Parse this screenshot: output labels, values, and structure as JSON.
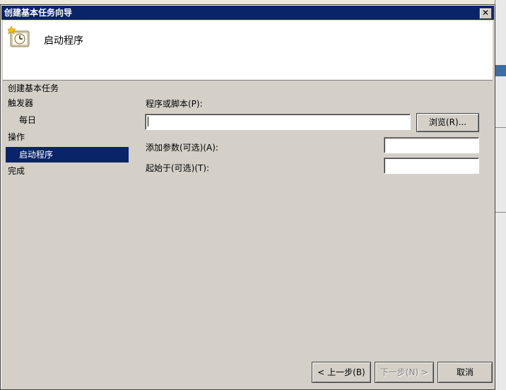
{
  "window": {
    "title": "创建基本任务向导",
    "close_symbol": "✕"
  },
  "header": {
    "title": "启动程序",
    "icon": "clock-icon"
  },
  "sidebar": {
    "heading": "创建基本任务",
    "items": [
      {
        "label": "触发器"
      },
      {
        "label": "每日"
      },
      {
        "label": "操作"
      },
      {
        "label": "启动程序"
      },
      {
        "label": "完成"
      }
    ]
  },
  "form": {
    "program_label": "程序或脚本(P):",
    "program_value": "",
    "browse_label": "浏览(R)...",
    "args_label": "添加参数(可选)(A):",
    "args_value": "",
    "startin_label": "起始于(可选)(T):",
    "startin_value": ""
  },
  "footer": {
    "back_label": "< 上一步(B)",
    "next_label": "下一步(N) >",
    "cancel_label": "取消"
  },
  "colors": {
    "selection": "#0a246a",
    "face": "#d4d0c8"
  }
}
